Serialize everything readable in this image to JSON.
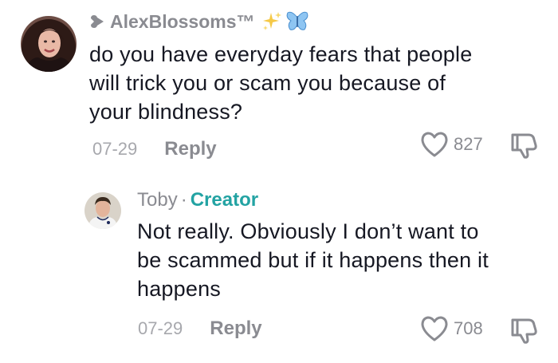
{
  "comment1": {
    "username": "AlexBlossoms™",
    "text_lines": [
      "do you have everyday fears that people",
      "will trick you or scam you because of",
      "your blindness?"
    ],
    "date": "07-29",
    "reply_label": "Reply",
    "like_count": "827"
  },
  "comment2": {
    "username": "Toby",
    "separator": "·",
    "badge": "Creator",
    "text_lines": [
      "Not really. Obviously I don’t want to",
      "be scammed but if it happens then it",
      "happens"
    ],
    "date": "07-29",
    "reply_label": "Reply",
    "like_count": "708"
  },
  "colors": {
    "username": "#8a8b91",
    "creator_badge": "#23a3a3",
    "body_text": "#161823"
  }
}
